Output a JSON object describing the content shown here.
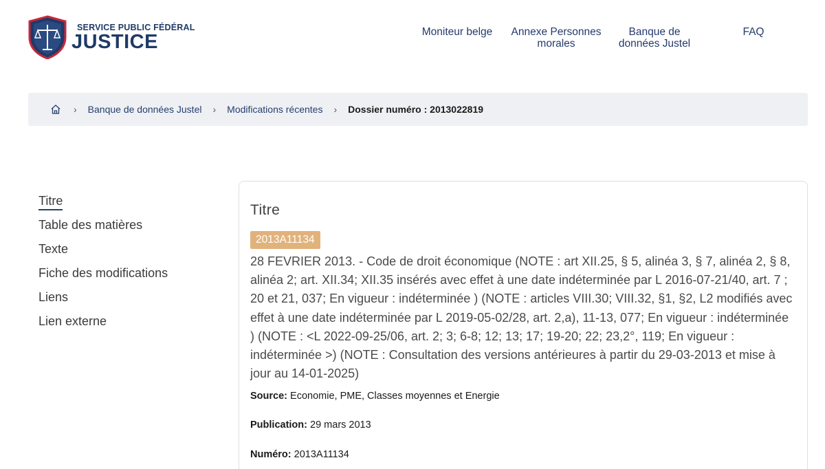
{
  "header": {
    "logo_small": "SERVICE PUBLIC FÉDÉRAL",
    "logo_big": "JUSTICE",
    "nav": [
      "Moniteur belge",
      "Annexe Personnes morales",
      "Banque de données Justel",
      "FAQ"
    ]
  },
  "breadcrumb": {
    "home_icon": "home-icon",
    "items": [
      "Banque de données Justel",
      "Modifications récentes"
    ],
    "current": "Dossier numéro : 2013022819"
  },
  "sidenav": {
    "items": [
      "Titre",
      "Table des matières",
      "Texte",
      "Fiche des modifications",
      "Liens",
      "Lien externe"
    ],
    "active": "Titre"
  },
  "main": {
    "title": "Titre",
    "tag": "2013A11134",
    "description": "28 FEVRIER 2013. - Code de droit économique (NOTE : art XII.25, § 5, alinéa 3, § 7, alinéa 2, § 8, alinéa 2; art. XII.34; XII.35 insérés avec effet à une date indéterminée par L 2016-07-21/40, art. 7 ; 20 et 21, 037; En vigueur : indéterminée ) (NOTE : articles VIII.30; VIII.32, §1, §2, L2 modifiés avec effet à une date indéterminée par L 2019-05-02/28, art. 2,a), 11-13, 077; En vigueur : indéterminée ) (NOTE : <L 2022-09-25/06, art. 2; 3; 6-8; 12; 13; 17; 19-20; 22; 23,2°, 119; En vigueur : indéterminée >) (NOTE : Consultation des versions antérieures à partir du 29-03-2013 et mise à jour au 14-01-2025)",
    "source_label": "Source:",
    "source_value": "Economie, PME, Classes moyennes et Energie",
    "publication_label": "Publication:",
    "publication_value": "29 mars 2013",
    "numero_label": "Numéro:",
    "numero_value": "2013A11134"
  },
  "colors": {
    "brand": "#1f3a68",
    "logo_red": "#c8283a",
    "tag_bg": "#e2b27b",
    "breadcrumb_bg": "#eef0f3"
  }
}
